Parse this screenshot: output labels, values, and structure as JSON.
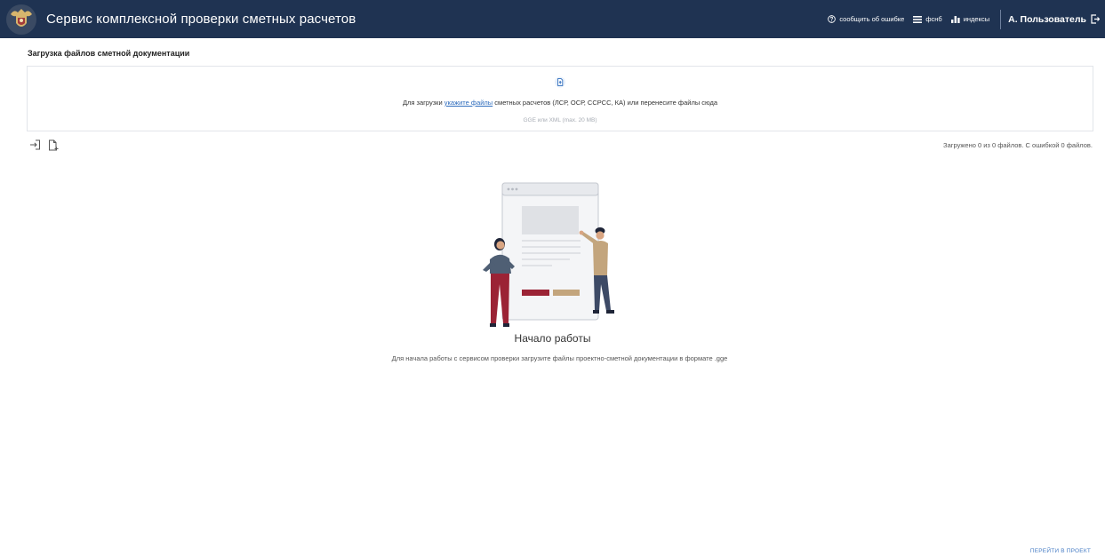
{
  "header": {
    "app_title": "Сервис комплексной проверки сметных расчетов",
    "report_error": "сообщить об ошибке",
    "fsnb": "фснб",
    "indexes": "индексы",
    "user_name": "А. Пользователь",
    "background_color": "#1f3352"
  },
  "upload": {
    "section_title": "Загрузка файлов сметной документации",
    "text_before": "Для загрузки ",
    "link": "укажите файлы",
    "text_after": " сметных расчетов (ЛСР, ОСР, ССРСС, КА) или перенесите файлы сюда",
    "hint": "GGE или XML (max. 20 MB)",
    "status": "Загружено 0 из 0 файлов. С ошибкой 0 файлов."
  },
  "empty_state": {
    "title": "Начало работы",
    "description": "Для начала работы с сервисом проверки загрузите файлы проектно-сметной документации в формате .gge"
  },
  "footer": {
    "goto_project": "перейти в проект"
  },
  "colors": {
    "accent_red": "#9b2335",
    "accent_tan": "#c3a57d",
    "link_blue": "#2f6dbd"
  }
}
